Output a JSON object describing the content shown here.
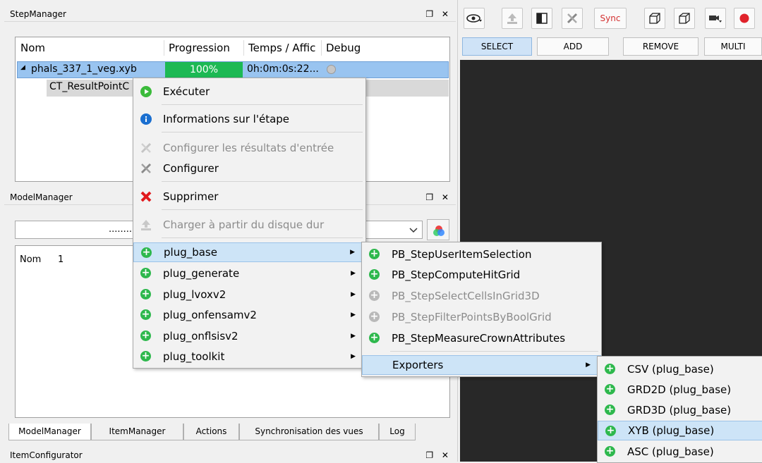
{
  "step_manager": {
    "title": "StepManager",
    "controls": "❐ ✕",
    "columns": [
      "Nom",
      "Progression",
      "Temps / Affic",
      "Debug"
    ],
    "row": {
      "name": "phals_337_1_veg.xyb",
      "progress": "100%",
      "progress_value": 100,
      "time": "0h:0m:0s:22...",
      "expand": "◢"
    },
    "child": {
      "name": "CT_ResultPointC"
    }
  },
  "model_manager": {
    "title": "ModelManager",
    "controls": "❐ ✕",
    "combo_text": "........",
    "columns": [
      "Nom",
      "1"
    ]
  },
  "tabs": [
    "ModelManager",
    "ItemManager",
    "Actions",
    "Synchronisation des vues",
    "Log"
  ],
  "item_configurator": {
    "title": "ItemConfigurator",
    "controls": "❐ ✕"
  },
  "view": {
    "sync_label": "Sync",
    "modes": [
      "SELECT",
      "ADD",
      "REMOVE",
      "MULTI"
    ]
  },
  "context_menu": {
    "items": [
      {
        "label": "Exécuter",
        "icon": "play-icon"
      },
      {
        "label": "Informations sur l'étape",
        "icon": "info-icon"
      },
      {
        "label": "Configurer les résultats d'entrée",
        "icon": "tools-icon",
        "disabled": true
      },
      {
        "label": "Configurer",
        "icon": "tools-icon"
      },
      {
        "label": "Supprimer",
        "icon": "delete-icon"
      },
      {
        "label": "Charger à partir du disque dur",
        "icon": "load-icon",
        "disabled": true
      },
      {
        "label": "plug_base",
        "icon": "plus-icon",
        "submenu": true
      },
      {
        "label": "plug_generate",
        "icon": "plus-icon",
        "submenu": true
      },
      {
        "label": "plug_lvoxv2",
        "icon": "plus-icon",
        "submenu": true
      },
      {
        "label": "plug_onfensamv2",
        "icon": "plus-icon",
        "submenu": true
      },
      {
        "label": "plug_onflsisv2",
        "icon": "plus-icon",
        "submenu": true
      },
      {
        "label": "plug_toolkit",
        "icon": "plus-icon",
        "submenu": true
      }
    ]
  },
  "plug_base_menu": {
    "items": [
      {
        "label": "PB_StepUserItemSelection"
      },
      {
        "label": "PB_StepComputeHitGrid"
      },
      {
        "label": "PB_StepSelectCellsInGrid3D",
        "disabled": true
      },
      {
        "label": "PB_StepFilterPointsByBoolGrid",
        "disabled": true
      },
      {
        "label": "PB_StepMeasureCrownAttributes"
      },
      {
        "label": "Exporters",
        "submenu": true
      }
    ]
  },
  "exporters_menu": {
    "items": [
      {
        "label": "CSV (plug_base)"
      },
      {
        "label": "GRD2D (plug_base)"
      },
      {
        "label": "GRD3D (plug_base)"
      },
      {
        "label": "XYB (plug_base)"
      },
      {
        "label": "ASC (plug_base)"
      }
    ]
  },
  "colors": {
    "selection": "#99c4f0",
    "progress": "#1db954",
    "viewport": "#282828",
    "sync": "#d32f2f",
    "plus": "#2eb84d"
  }
}
